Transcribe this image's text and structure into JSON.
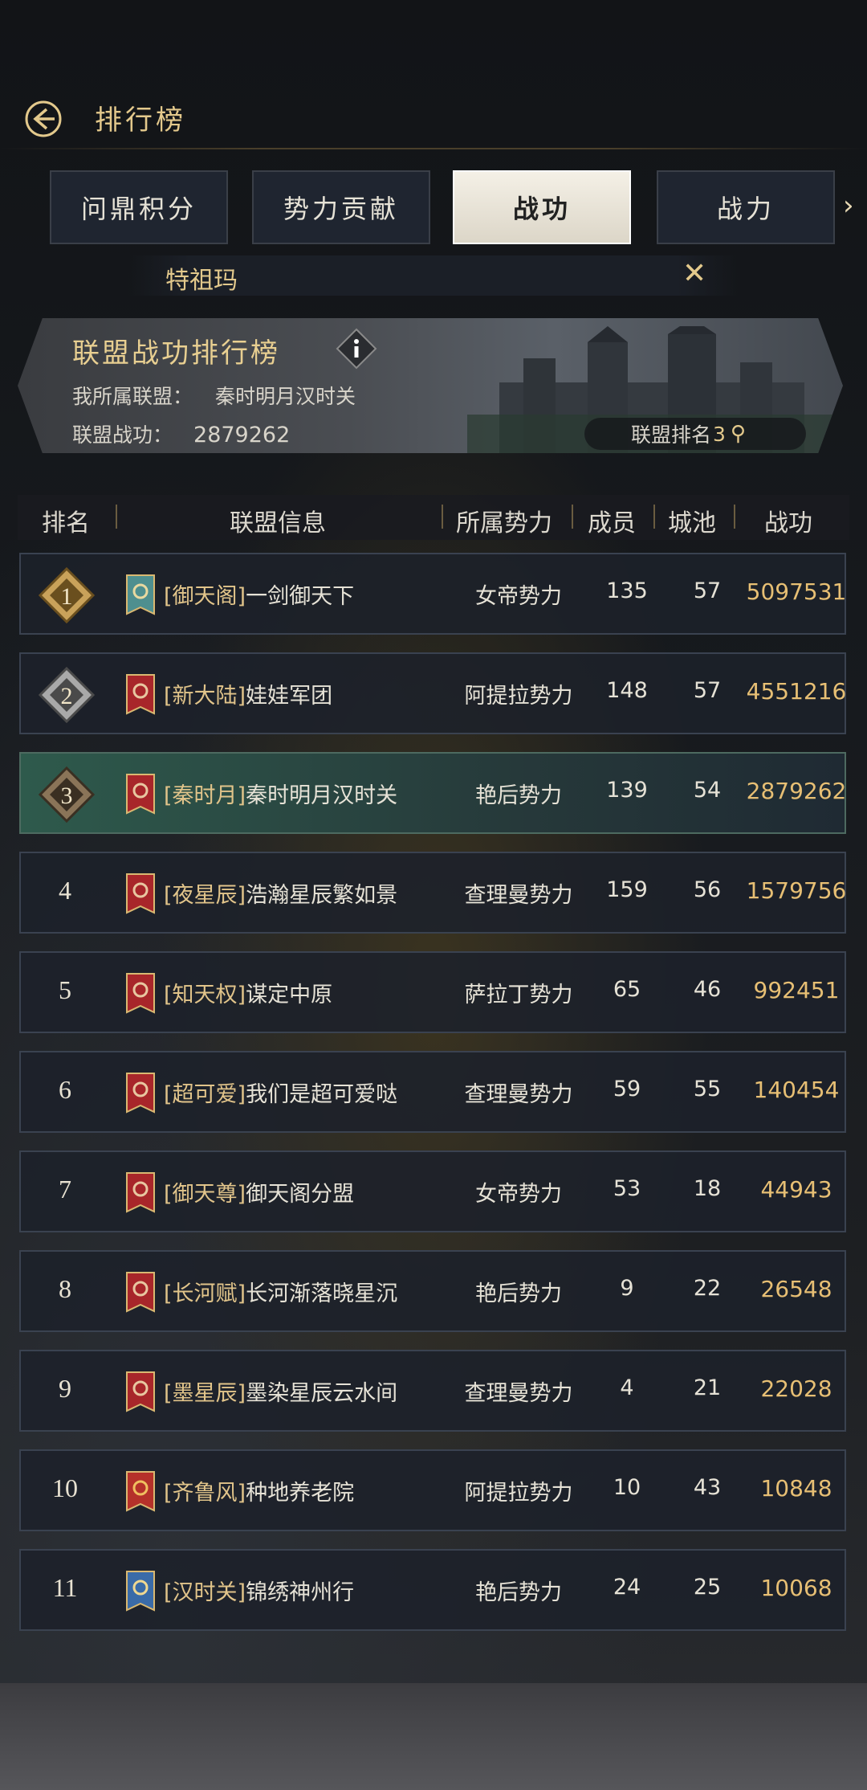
{
  "header": {
    "title": "排行榜"
  },
  "tabs": [
    {
      "label": "问鼎积分",
      "active": false
    },
    {
      "label": "势力贡献",
      "active": false
    },
    {
      "label": "战功",
      "active": true
    },
    {
      "label": "战力",
      "active": false
    }
  ],
  "search": {
    "value": "特祖玛"
  },
  "banner": {
    "title": "联盟战功排行榜",
    "my_alliance_label": "我所属联盟：",
    "my_alliance_value": "秦时明月汉时关",
    "merit_label": "联盟战功：",
    "merit_value": "2879262",
    "rank_label": "联盟排名",
    "rank_value": "3"
  },
  "columns": [
    "排名",
    "联盟信息",
    "所属势力",
    "成员",
    "城池",
    "战功"
  ],
  "rows": [
    {
      "rank": "1",
      "tag": "[御天阁]",
      "name": "一剑御天下",
      "faction": "女帝势力",
      "members": "135",
      "cities": "57",
      "merit": "5097531",
      "flag": "teal-lion-flag"
    },
    {
      "rank": "2",
      "tag": "[新大陆]",
      "name": "娃娃军团",
      "faction": "阿提拉势力",
      "members": "148",
      "cities": "57",
      "merit": "4551216",
      "flag": "red-dragon-flag"
    },
    {
      "rank": "3",
      "tag": "[秦时月]",
      "name": "秦时明月汉时关",
      "faction": "艳后势力",
      "members": "139",
      "cities": "54",
      "merit": "2879262",
      "flag": "red-dragon-flag"
    },
    {
      "rank": "4",
      "tag": "[夜星辰]",
      "name": "浩瀚星辰繁如景",
      "faction": "查理曼势力",
      "members": "159",
      "cities": "56",
      "merit": "1579756",
      "flag": "red-dragon-flag"
    },
    {
      "rank": "5",
      "tag": "[知天权]",
      "name": "谋定中原",
      "faction": "萨拉丁势力",
      "members": "65",
      "cities": "46",
      "merit": "992451",
      "flag": "red-dragon-flag"
    },
    {
      "rank": "6",
      "tag": "[超可爱]",
      "name": "我们是超可爱哒",
      "faction": "查理曼势力",
      "members": "59",
      "cities": "55",
      "merit": "140454",
      "flag": "red-dragon-flag"
    },
    {
      "rank": "7",
      "tag": "[御天尊]",
      "name": "御天阁分盟",
      "faction": "女帝势力",
      "members": "53",
      "cities": "18",
      "merit": "44943",
      "flag": "red-dragon-flag"
    },
    {
      "rank": "8",
      "tag": "[长河赋]",
      "name": "长河渐落晓星沉",
      "faction": "艳后势力",
      "members": "9",
      "cities": "22",
      "merit": "26548",
      "flag": "red-dragon-flag"
    },
    {
      "rank": "9",
      "tag": "[墨星辰]",
      "name": "墨染星辰云水间",
      "faction": "查理曼势力",
      "members": "4",
      "cities": "21",
      "merit": "22028",
      "flag": "red-dragon-flag"
    },
    {
      "rank": "10",
      "tag": "[齐鲁风]",
      "name": "种地养老院",
      "faction": "阿提拉势力",
      "members": "10",
      "cities": "43",
      "merit": "10848",
      "flag": "red-wreath-flag"
    },
    {
      "rank": "11",
      "tag": "[汉时关]",
      "name": "锦绣神州行",
      "faction": "艳后势力",
      "members": "24",
      "cities": "25",
      "merit": "10068",
      "flag": "blue-griffin-flag"
    }
  ],
  "colors": {
    "gold": "#e3c98c",
    "merit": "#e7bf74",
    "my_row": "#2e5a4c"
  }
}
